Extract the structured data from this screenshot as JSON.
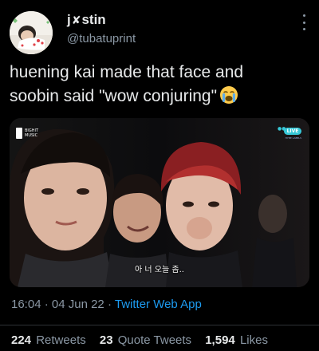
{
  "author": {
    "name_part1": "j",
    "name_emoji": "✘",
    "name_part2": "stin",
    "handle": "@tubatuprint",
    "avatar_icon": "profile-photo"
  },
  "tweet": {
    "line1": "huening kai made that face and",
    "line2": "soobin said \"wow conjuring\"",
    "emoji": "loudly-crying-face"
  },
  "media": {
    "subtitle": "아 너 오늘 좀..",
    "logo_text_line1": "BIGHIT",
    "logo_text_line2": "MUSIC",
    "badge_label": "LIVE",
    "badge_sub": "HYBE LABELS"
  },
  "meta": {
    "time": "16:04",
    "date": "04 Jun 22",
    "separator": "·",
    "source": "Twitter Web App"
  },
  "stats": {
    "retweets_count": "224",
    "retweets_label": "Retweets",
    "quotes_count": "23",
    "quotes_label": "Quote Tweets",
    "likes_count": "1,594",
    "likes_label": "Likes"
  },
  "colors": {
    "background": "#000000",
    "text": "#e7e9ea",
    "secondary": "#8b98a5",
    "link": "#1d9bf0"
  }
}
